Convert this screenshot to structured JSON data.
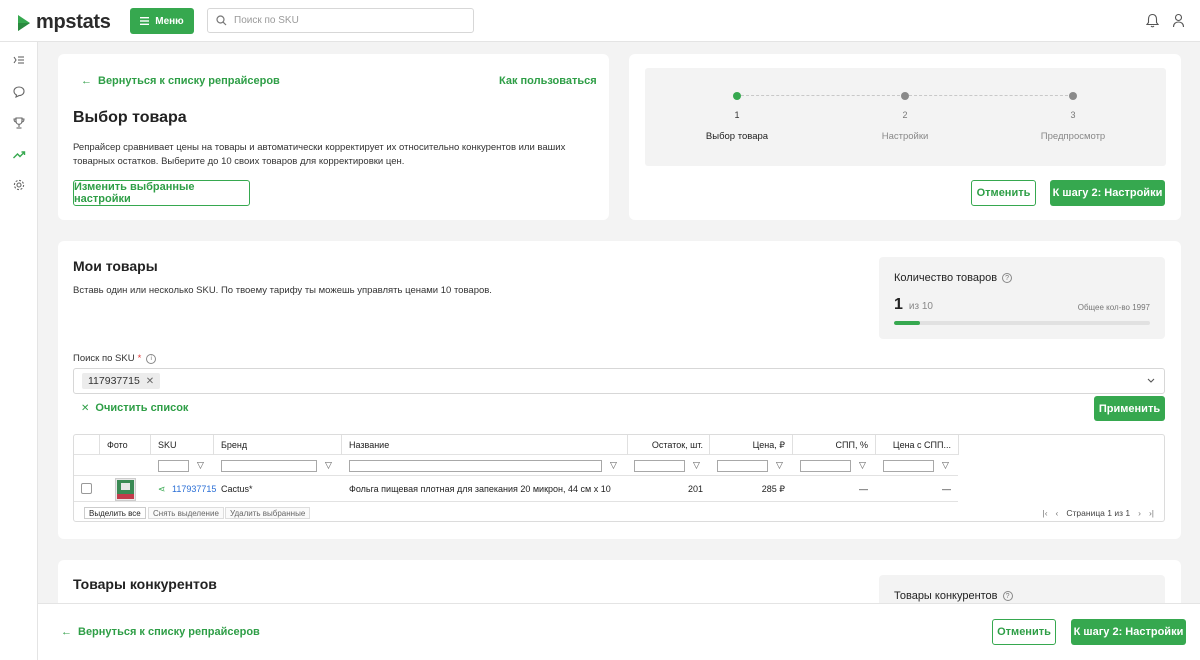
{
  "app": {
    "logo": "mpstats"
  },
  "header": {
    "menu_label": "Меню",
    "search_placeholder": "Поиск по SKU"
  },
  "select_card": {
    "back_link": "Вернуться к списку репрайсеров",
    "help_link": "Как пользоваться",
    "title": "Выбор товара",
    "description": "Репрайсер сравнивает цены на товары и автоматически корректирует их относительно конкурентов или ваших товарных остатков. Выберите до 10 своих товаров для корректировки цен.",
    "change_settings_button": "Изменить выбранные настройки"
  },
  "stepper": {
    "steps": [
      {
        "num": "1",
        "label": "Выбор товара"
      },
      {
        "num": "2",
        "label": "Настройки"
      },
      {
        "num": "3",
        "label": "Предпросмотр"
      }
    ],
    "cancel_button": "Отменить",
    "next_button": "К шагу 2: Настройки"
  },
  "my_products": {
    "title": "Мои товары",
    "description": "Вставь один или несколько SKU. По твоему тарифу ты можешь управлять ценами 10 товаров.",
    "quantity_title": "Количество товаров",
    "quantity_current": "1",
    "quantity_of": "из 10",
    "quantity_total": "Общее кол-во 1997",
    "quantity_progress": 0.1,
    "search_label": "Поиск по SKU",
    "required_mark": "*",
    "selected_sku": "117937715",
    "clear_link": "Очистить список",
    "apply_button": "Применить",
    "columns": [
      "Фото",
      "SKU",
      "Бренд",
      "Название",
      "Остаток, шт.",
      "Цена, ₽",
      "СПП, %",
      "Цена с СПП..."
    ],
    "rows": [
      {
        "sku": "117937715",
        "brand": "Cactus*",
        "name": "Фольга пищевая плотная для запекания 20 микрон, 44 см х 10 м",
        "stock": "201",
        "price": "285 ₽",
        "spp": "—",
        "price_spp": "—"
      }
    ],
    "footer_buttons": [
      "Выделить все",
      "Снять выделение",
      "Удалить выбранные"
    ],
    "pagination": "Страница 1 из 1"
  },
  "competitors": {
    "title": "Товары конкурентов",
    "side_title": "Товары конкурентов"
  },
  "bottom_bar": {
    "back_link": "Вернуться к списку репрайсеров",
    "cancel_button": "Отменить",
    "next_button": "К шагу 2: Настройки"
  },
  "colors": {
    "accent": "#36a84f",
    "link": "#2e9e46",
    "sku_link": "#2b6fd6"
  }
}
